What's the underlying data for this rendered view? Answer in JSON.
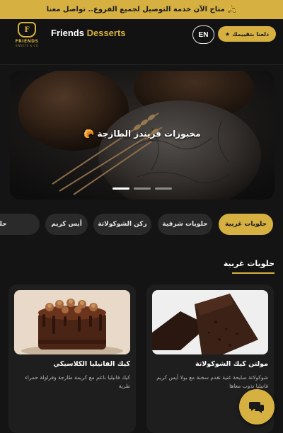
{
  "topbar": {
    "text": "متاح الآن خدمة التوصيل لجميع الفروع.. تواصل معنا",
    "icon": "motorcycle-icon"
  },
  "header": {
    "logo_text": "FRIENDS",
    "logo_subtext": "SWEETS & CO",
    "brand_part1": "Friends",
    "brand_part2": "Desserts",
    "lang_button": "EN",
    "rate_button": "دلعنا بتقييمك",
    "rate_icon": "star-icon"
  },
  "hero": {
    "title": "مخبوزات فريندز الطازجة",
    "slides": 3,
    "active_slide": 1
  },
  "categories": [
    {
      "label": "حلويات غربية",
      "active": true
    },
    {
      "label": "حلويات شرقية",
      "active": false
    },
    {
      "label": "ركن الشوكولاتة",
      "active": false
    },
    {
      "label": "أيس كريم",
      "active": false
    },
    {
      "label": "حلويات",
      "active": false
    }
  ],
  "section": {
    "title": "حلويات غربية"
  },
  "products": [
    {
      "title": "مولتن كيك الشوكولاتة",
      "description": "شوكولاتة سايحة غنية تقدم سخنة مع بولا أيس كريم فانيليا تذوب معاها"
    },
    {
      "title": "كيك الفانيليا الكلاسيكي",
      "description": "كيك فانيليا ناعم مع كريمة طازجة وفراولة حمراء طرية"
    }
  ],
  "colors": {
    "accent": "#d6b040",
    "background": "#141414",
    "card": "#1e1e1e"
  },
  "chat": {
    "icon": "chat-icon"
  }
}
